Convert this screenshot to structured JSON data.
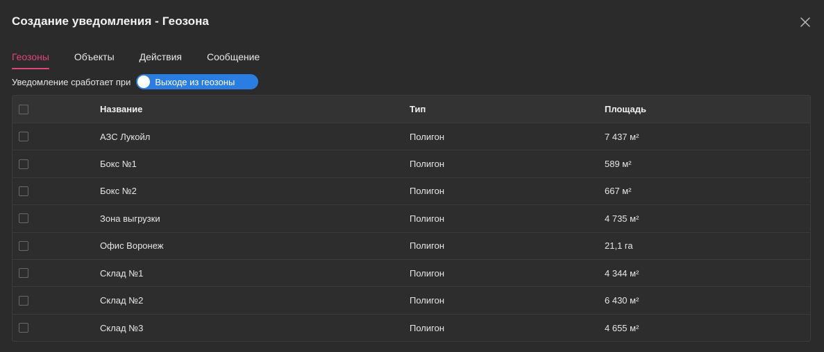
{
  "dialog": {
    "title": "Создание уведомления - Геозона"
  },
  "tabs": [
    {
      "label": "Геозоны",
      "active": true
    },
    {
      "label": "Объекты",
      "active": false
    },
    {
      "label": "Действия",
      "active": false
    },
    {
      "label": "Сообщение",
      "active": false
    }
  ],
  "trigger": {
    "label": "Уведомление сработает при",
    "toggle_label": "Выходе из геозоны"
  },
  "table": {
    "columns": {
      "name": "Название",
      "type": "Тип",
      "area": "Площадь"
    },
    "rows": [
      {
        "name": "АЗС Лукойл",
        "type": "Полигон",
        "area": "7 437 м²"
      },
      {
        "name": "Бокс №1",
        "type": "Полигон",
        "area": "589 м²"
      },
      {
        "name": "Бокс №2",
        "type": "Полигон",
        "area": "667 м²"
      },
      {
        "name": "Зона выгрузки",
        "type": "Полигон",
        "area": "4 735 м²"
      },
      {
        "name": "Офис Воронеж",
        "type": "Полигон",
        "area": "21,1 га"
      },
      {
        "name": "Склад №1",
        "type": "Полигон",
        "area": "4 344 м²"
      },
      {
        "name": "Склад №2",
        "type": "Полигон",
        "area": "6 430 м²"
      },
      {
        "name": "Склад №3",
        "type": "Полигон",
        "area": "4 655 м²"
      }
    ]
  },
  "colors": {
    "accent": "#e0457b",
    "toggle": "#2a7de1",
    "background": "#2b2b2b"
  },
  "icons": {
    "close": "close-icon"
  }
}
